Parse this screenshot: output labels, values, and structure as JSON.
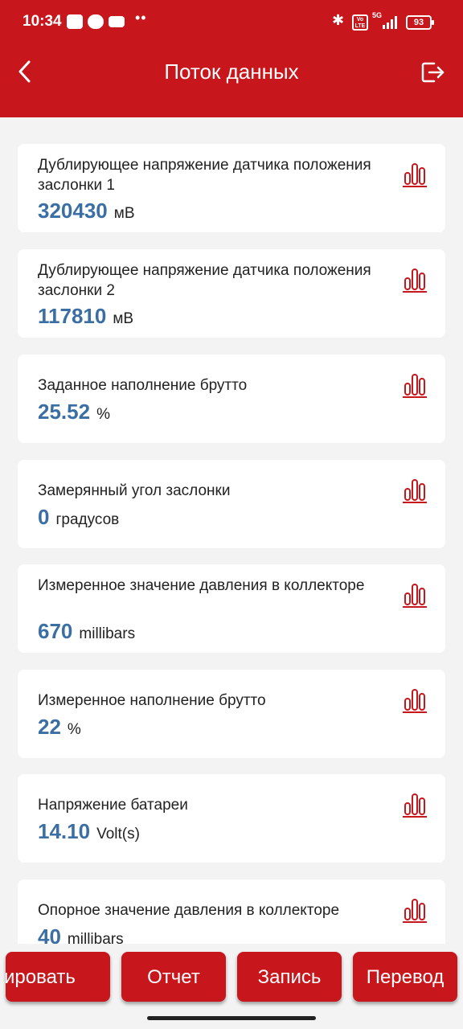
{
  "status_bar": {
    "time": "10:34",
    "network": "5G",
    "battery": "93"
  },
  "header": {
    "title": "Поток данных"
  },
  "items": [
    {
      "name": "Дублирующее  напряжение датчика положения заслонки 1",
      "value": "320430",
      "unit": "мВ"
    },
    {
      "name": "Дублирующее  напряжение датчика положения заслонки 2",
      "value": "117810",
      "unit": "мВ"
    },
    {
      "name": "Заданное наполнение брутто",
      "value": "25.52",
      "unit": "%"
    },
    {
      "name": "Замерянный угол заслонки",
      "value": "0",
      "unit": "градусов"
    },
    {
      "name": "Измеренное значение давления в коллекторе",
      "value": "670",
      "unit": "millibars"
    },
    {
      "name": "Измеренное наполнение брутто",
      "value": "22",
      "unit": "%"
    },
    {
      "name": "Напряжение батареи",
      "value": "14.10",
      "unit": "Volt(s)"
    },
    {
      "name": "Опорное значение давления в коллекторе",
      "value": "40",
      "unit": "millibars"
    }
  ],
  "bottom_buttons": {
    "b1": "ировать",
    "b2": "Отчет",
    "b3": "Запись",
    "b4": "Перевод"
  },
  "colors": {
    "brand_red": "#c8171c",
    "value_blue": "#3b6fa4"
  }
}
